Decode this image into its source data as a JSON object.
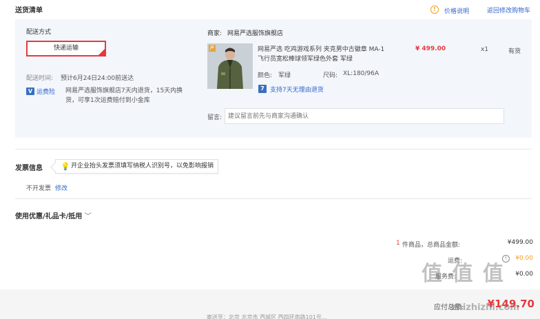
{
  "header": {
    "title": "送货清单",
    "price_info_link": "价格说明",
    "back_to_cart_link": "返回修改购物车"
  },
  "shipping": {
    "label": "配送方式",
    "method_button": "快递运输",
    "time_label": "配送时间:",
    "time_value": "预计6月24日24:00前送达",
    "insurance_badge": "运费险",
    "insurance_text": "网易严选服饰旗舰店7天内退货，15天内换货，可享1次运费赔付到小金库"
  },
  "shop": {
    "label": "商家:",
    "name": "网易严选服饰旗舰店"
  },
  "product": {
    "title": "网易严选 吃鸡游戏系列 夹克男中古徽章 MA-1飞行员宽松棒球领军绿色外套 军绿",
    "price": "¥ 499.00",
    "quantity": "x1",
    "stock": "有货",
    "color_label": "颜色:",
    "color_value": "军绿",
    "size_label": "尺码:",
    "size_value": "XL:180/96A",
    "return_policy": "支持7天无理由退货",
    "thumb_badge": "严"
  },
  "message": {
    "label": "留言:",
    "placeholder": "建议留言前先与商家沟通确认"
  },
  "invoice": {
    "title": "发票信息",
    "tip": "开企业抬头发票须填写纳税人识别号，以免影响报销",
    "status": "不开发票",
    "edit_link": "修改"
  },
  "coupon": {
    "title": "使用优惠/礼品卡/抵用"
  },
  "summary": {
    "item_count": "1",
    "item_count_text": "件商品，总商品金额:",
    "goods_total": "¥499.00",
    "shipping_label": "运费:",
    "shipping_value": "¥0.00",
    "service_label": "服务费:",
    "service_value": "¥0.00",
    "payable_label": "应付总额:",
    "payable_value": "¥149.70"
  },
  "footer": {
    "address_text": "寄送至：北京 北京市 西城区 西四环南路101号..."
  },
  "watermark": {
    "text": "值 值 值",
    "url": "zhizhizhi.com"
  },
  "colors": {
    "accent_red": "#e4393c",
    "link_blue": "#3366cc",
    "panel_bg": "#f3f6fb",
    "warning_orange": "#f0a020"
  }
}
